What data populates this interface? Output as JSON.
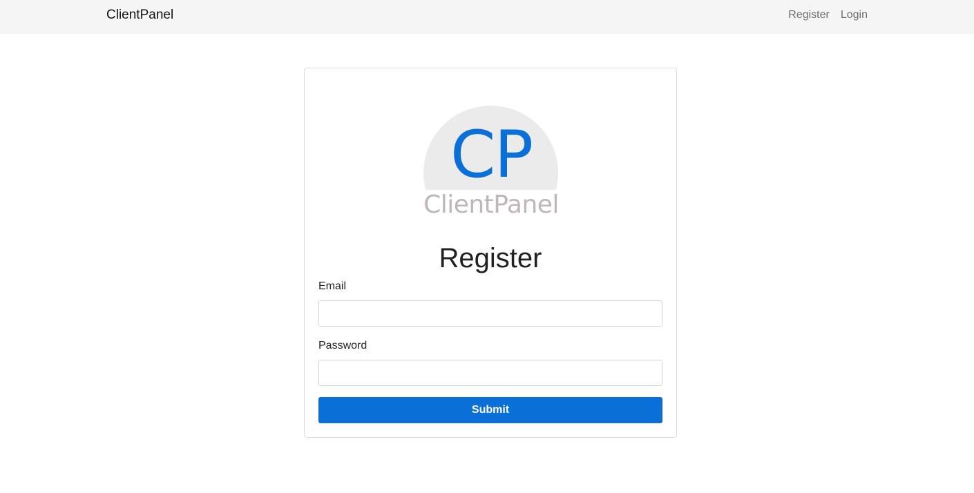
{
  "navbar": {
    "brand": "ClientPanel",
    "links": [
      {
        "label": "Register"
      },
      {
        "label": "Login"
      }
    ]
  },
  "logo": {
    "monogram": "CP",
    "wordmark": "ClientPanel"
  },
  "form": {
    "heading": "Register",
    "email_label": "Email",
    "email_value": "",
    "password_label": "Password",
    "password_value": "",
    "submit_label": "Submit"
  },
  "colors": {
    "accent": "#0a6fd6",
    "navbar_bg": "#f5f5f5",
    "logo_circle": "#ebebeb",
    "logo_wordmark": "#bfb6b8"
  }
}
